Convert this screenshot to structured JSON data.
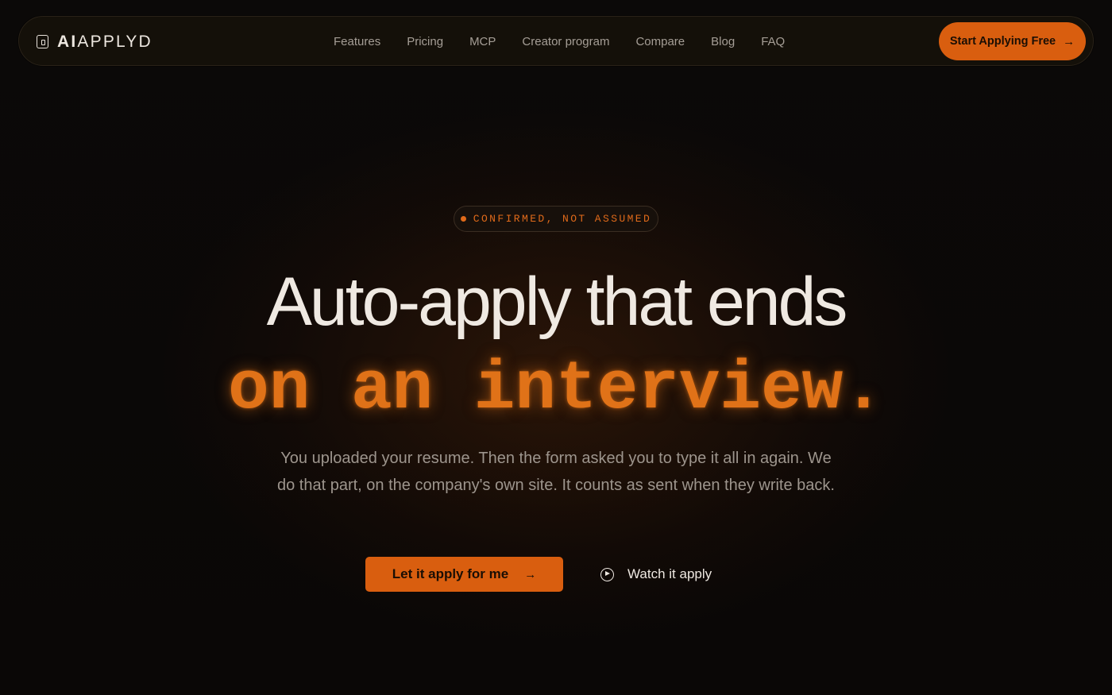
{
  "nav": {
    "logo_bold": "AI",
    "logo_light": "APPLYD",
    "links": [
      "Features",
      "Pricing",
      "MCP",
      "Creator program",
      "Compare",
      "Blog",
      "FAQ"
    ],
    "cta_label": "Start Applying Free",
    "cta_icon": "arrow-right-icon"
  },
  "hero": {
    "badge": "CONFIRMED, NOT ASSUMED",
    "headline_line1": "Auto-apply that ends",
    "headline_line2": "on an interview.",
    "subtext": "You uploaded your resume. Then the form asked you to type it all in again. We do that part, on the company's own site. It counts as sent when they write back.",
    "primary_cta": "Let it apply for me",
    "secondary_cta": "Watch it apply",
    "secondary_icon": "play-circle-icon"
  },
  "colors": {
    "accent": "#d95e0f",
    "accent_text": "#e07218",
    "background": "#0a0807"
  }
}
